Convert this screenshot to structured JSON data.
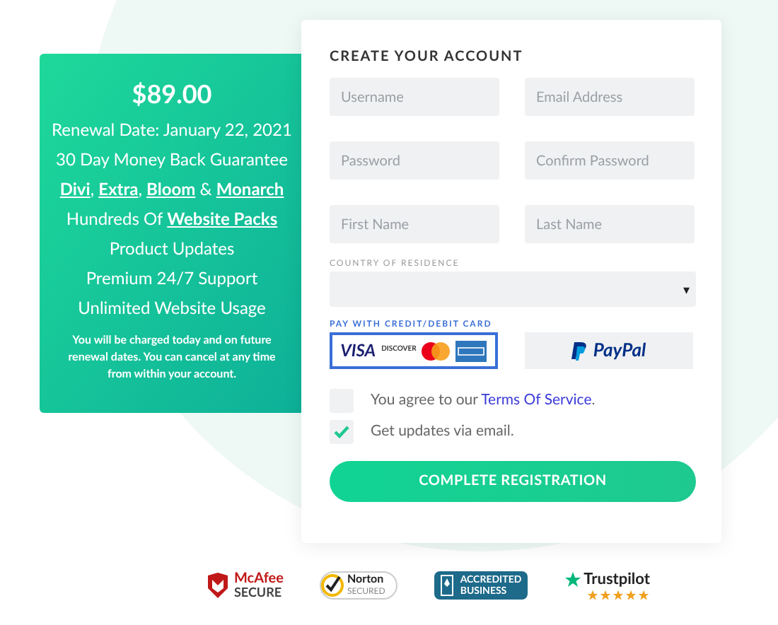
{
  "plan": {
    "price": "$89.00",
    "features": [
      "Renewal Date: January 22, 2021",
      "30 Day Money Back Guarantee",
      "**Divi**, **Extra**, **Bloom** & **Monarch**",
      "Hundreds Of **Website Packs**",
      "Product Updates",
      "Premium 24/7 Support",
      "Unlimited Website Usage"
    ],
    "note": "You will be charged today and on future renewal dates. You can cancel at any time from within your account."
  },
  "form": {
    "title": "CREATE YOUR ACCOUNT",
    "fields": [
      {
        "placeholder": "Username"
      },
      {
        "placeholder": "Email Address"
      },
      {
        "placeholder": "Password"
      },
      {
        "placeholder": "Confirm Password"
      },
      {
        "placeholder": "First Name"
      },
      {
        "placeholder": "Last Name"
      }
    ],
    "country": {
      "label": "COUNTRY OF RESIDENCE",
      "arrow": "▾"
    },
    "payment": {
      "label": "PAY WITH CREDIT/DEBIT CARD",
      "options": [
        {
          "kind": "card",
          "selected": true,
          "brands": [
            "VISA",
            "DISCOVER"
          ]
        },
        {
          "kind": "paypal",
          "selected": false,
          "label": "PayPal"
        }
      ]
    },
    "checks": [
      {
        "before": "You agree to our ",
        "link": "Terms Of Service",
        "after": ".",
        "checked": false
      },
      {
        "before": "Get updates via email.",
        "checked": true
      }
    ],
    "submit": "COMPLETE REGISTRATION"
  },
  "badges": [
    {
      "kind": "mcafee",
      "lines": [
        "McAfee",
        "SECURE"
      ]
    },
    {
      "kind": "norton",
      "lines": [
        "Norton",
        "SECURED"
      ]
    },
    {
      "kind": "bbb",
      "lines": [
        "ACCREDITED",
        "BUSINESS"
      ]
    },
    {
      "kind": "trustpilot",
      "lines": [
        "Trustpilot"
      ],
      "stars": 5
    }
  ]
}
